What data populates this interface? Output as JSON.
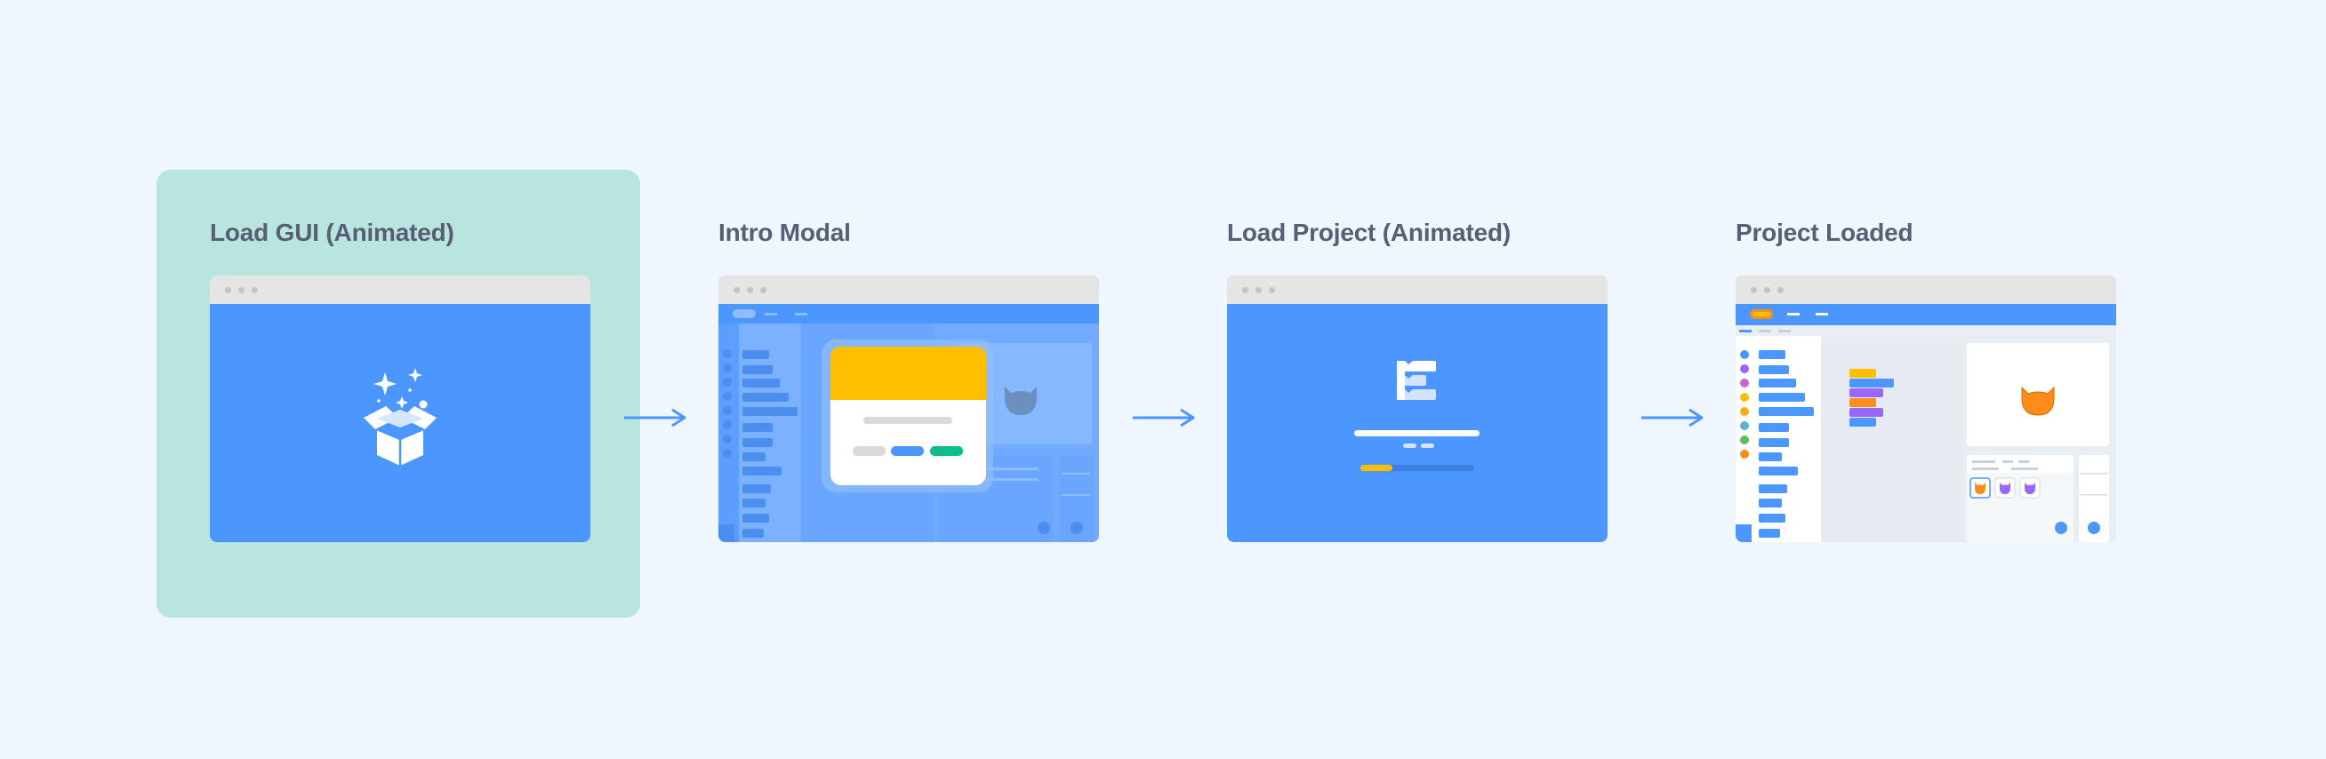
{
  "steps": [
    {
      "label": "Load GUI (Animated)",
      "icon": "open-box-sparkles-icon"
    },
    {
      "label": "Intro Modal"
    },
    {
      "label": "Load Project (Animated)",
      "icon": "loading-blocks-icon"
    },
    {
      "label": "Project Loaded",
      "icon": "cat-sprite-icon"
    }
  ],
  "colors": {
    "background": "#f0f6fd",
    "highlight": "#b8e6df",
    "window_blue": "#4c97ff",
    "label": "#575e75",
    "modal_header": "#ffbf00",
    "accent_green": "#0fbd8c",
    "sprite_orange": "#ff8c1a",
    "block_purple": "#9966ff"
  }
}
